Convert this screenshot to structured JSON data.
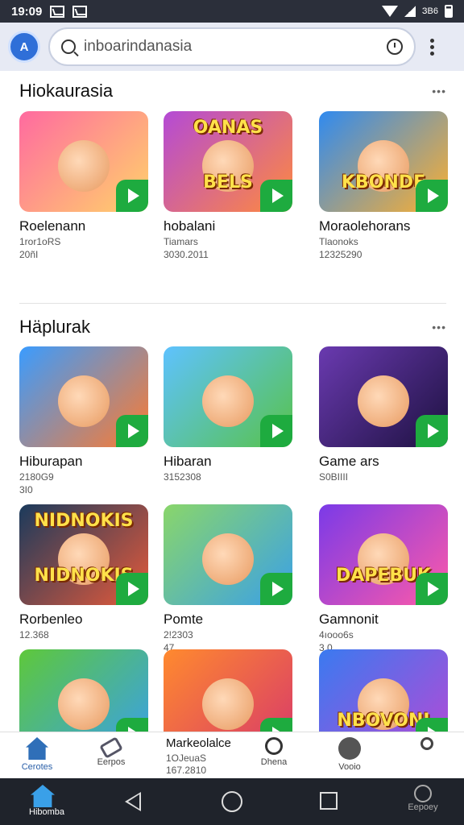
{
  "status_bar": {
    "time": "19:09",
    "right_text": "ЗВ6"
  },
  "search": {
    "app_icon_letter": "A",
    "query": "inboarindanasia"
  },
  "sections": [
    {
      "title": "Hiokaurasia"
    },
    {
      "title": "Häplurak"
    }
  ],
  "cards": [
    {
      "title": "Roelenann",
      "meta1": "1ror1oRS",
      "meta2": "20ñI",
      "art": "",
      "colors": [
        "#ff6aa0",
        "#ffd36a"
      ]
    },
    {
      "title": "hobalani",
      "meta1": "Tiamars",
      "meta2": "3030.2011",
      "art": "BELS",
      "art_top": "OANAS",
      "colors": [
        "#b44ad6",
        "#ff8a3d"
      ]
    },
    {
      "title": "Moraolehorans",
      "meta1": "Tlaonoks",
      "meta2": "12325290",
      "art": "KBONDE",
      "colors": [
        "#2f8af0",
        "#ffb02e"
      ]
    },
    {
      "title": "Hiburapan",
      "meta1": "2180G9",
      "meta2": "3I0",
      "art": "",
      "colors": [
        "#3a9cff",
        "#ff7a2e"
      ]
    },
    {
      "title": "Hibaran",
      "meta1": "3152308",
      "meta2": "",
      "art": "",
      "colors": [
        "#5ec2ff",
        "#58c24a"
      ]
    },
    {
      "title": "Game ars",
      "meta1": "S0BIIII",
      "meta2": "",
      "art": "",
      "colors": [
        "#6a3ab0",
        "#1d1140"
      ]
    },
    {
      "title": "Rorbenleo",
      "meta1": "12.368",
      "meta2": "",
      "art": "NIDNOKIS",
      "art_top": "NIDNOKIS",
      "colors": [
        "#1a3a5c",
        "#e85a3a"
      ]
    },
    {
      "title": "Pomte",
      "meta1": "2!2303",
      "meta2": "47",
      "art": "",
      "colors": [
        "#8ad66a",
        "#3aa0e8"
      ]
    },
    {
      "title": "Gamnonit",
      "meta1": "4ıooo6s",
      "meta2": "3 0",
      "art": "DAPEBUK",
      "colors": [
        "#7a3ae8",
        "#ff5aa8"
      ]
    },
    {
      "title": "",
      "meta1": "",
      "meta2": "",
      "art": "",
      "colors": [
        "#5ec83a",
        "#3aa0e8"
      ]
    },
    {
      "title": "",
      "meta1": "",
      "meta2": "",
      "art": "",
      "colors": [
        "#ff8a2e",
        "#d83a6a"
      ]
    },
    {
      "title": "",
      "meta1": "",
      "meta2": "",
      "art": "NBOVONI",
      "colors": [
        "#3a7af0",
        "#b44ad6"
      ]
    }
  ],
  "bottom_nav": {
    "items": [
      {
        "label": "Cerotes"
      },
      {
        "label": "Eerpos"
      },
      {
        "label": "Dhena"
      },
      {
        "label": "Vooio"
      },
      {
        "label": ""
      }
    ],
    "market_title": "Markeolalce",
    "market_meta1": "1OJeuaS",
    "market_meta2": "167.2810"
  },
  "system_nav": {
    "home_label": "Hibomba",
    "profile_label": "Eepoey"
  }
}
